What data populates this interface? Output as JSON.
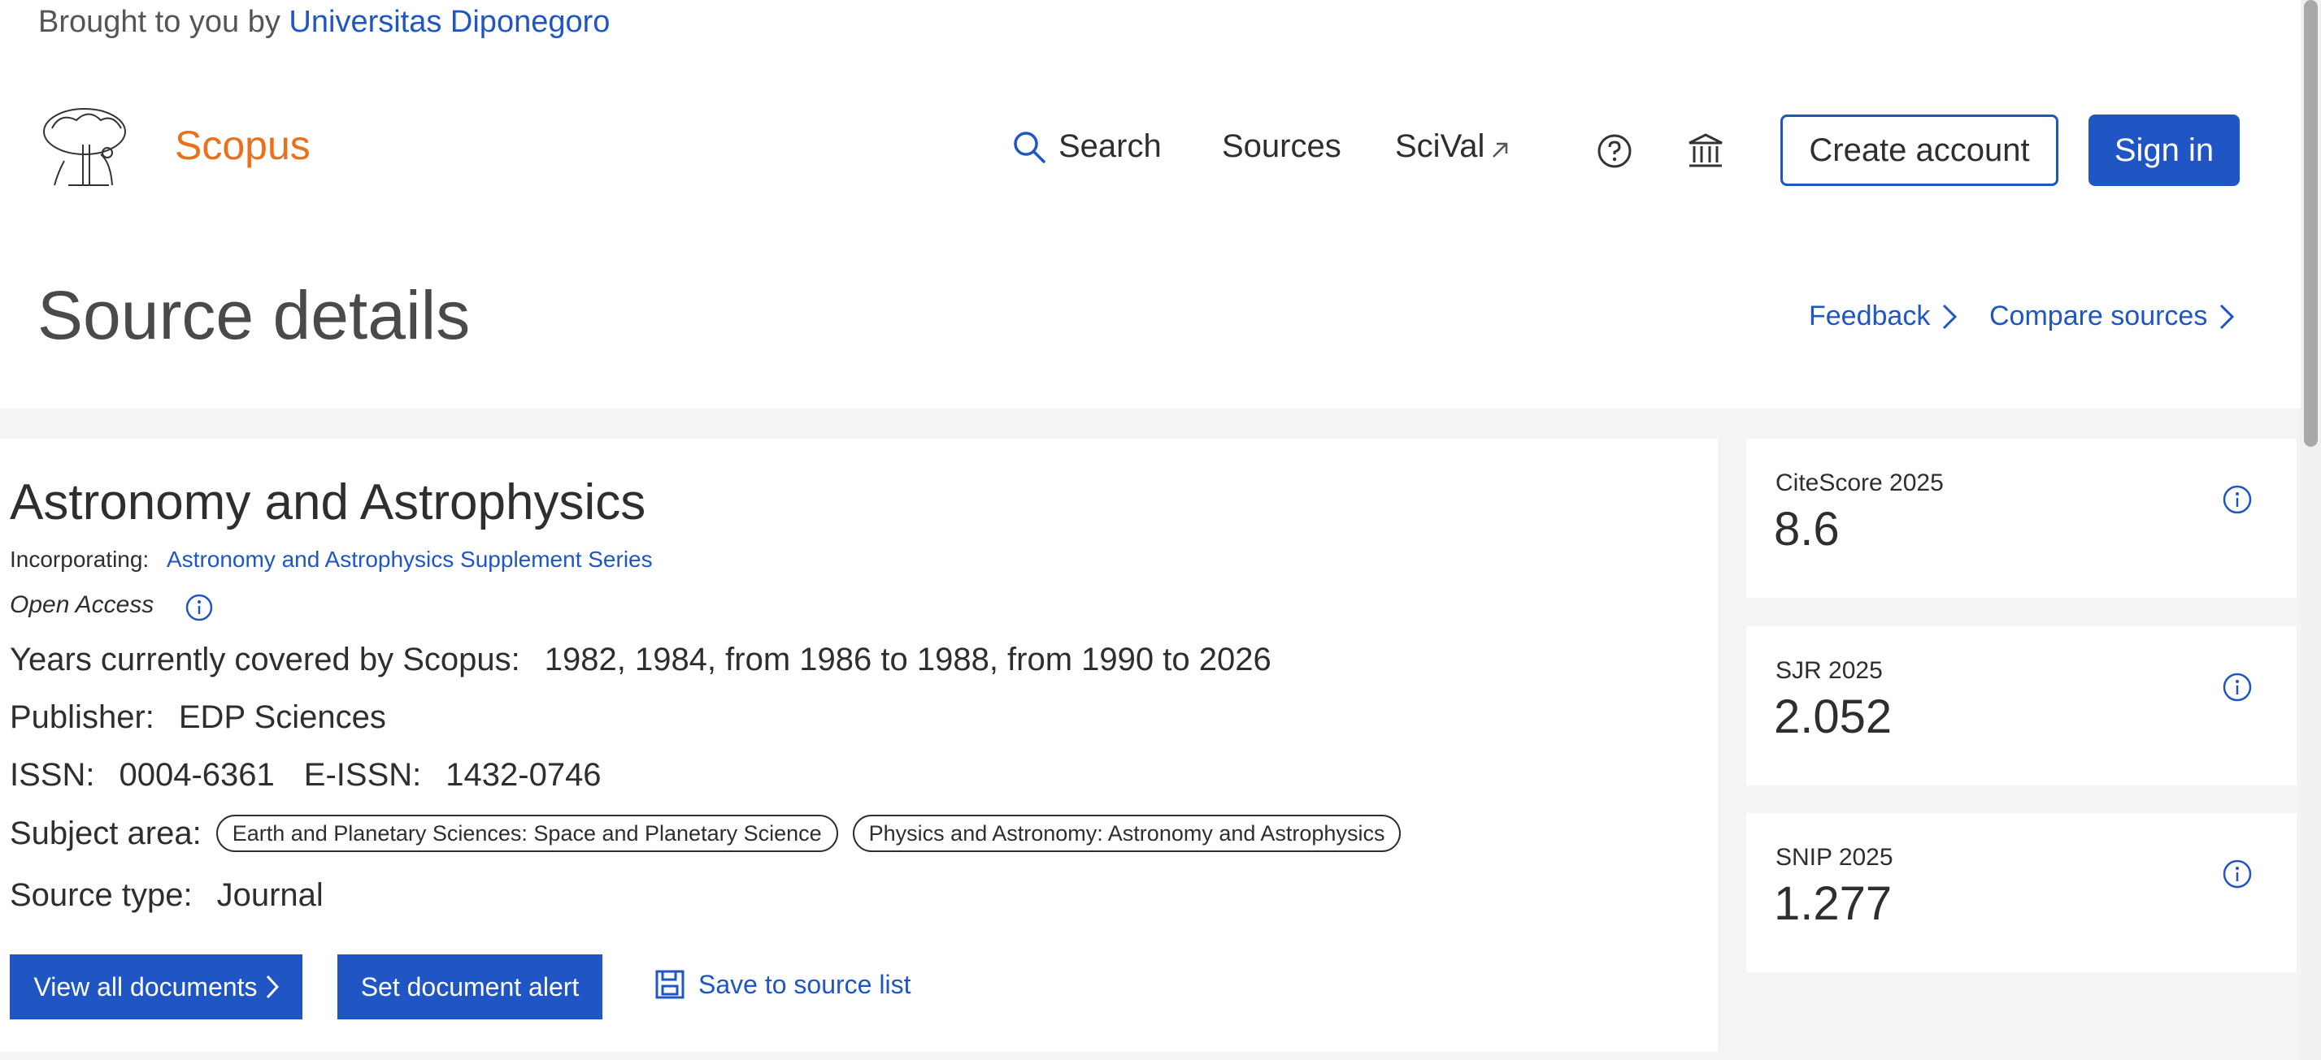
{
  "header": {
    "brought_prefix": "Brought to you by",
    "institution": "Universitas Diponegoro",
    "brand": "Scopus"
  },
  "nav": {
    "search": "Search",
    "sources": "Sources",
    "scival": "SciVal",
    "create_account": "Create account",
    "sign_in": "Sign in"
  },
  "page": {
    "title": "Source details",
    "feedback": "Feedback",
    "compare": "Compare sources"
  },
  "source": {
    "title": "Astronomy and Astrophysics",
    "incorporating_label": "Incorporating:",
    "incorporating_value": "Astronomy and Astrophysics Supplement Series",
    "open_access": "Open Access",
    "years_label": "Years currently covered by Scopus:",
    "years_value": "1982, 1984, from 1986 to 1988, from 1990 to 2026",
    "publisher_label": "Publisher:",
    "publisher_value": "EDP Sciences",
    "issn_label": "ISSN:",
    "issn_value": "0004-6361",
    "eissn_label": "E-ISSN:",
    "eissn_value": "1432-0746",
    "subject_label": "Subject area:",
    "subjects": [
      "Earth and Planetary Sciences: Space and Planetary Science",
      "Physics and Astronomy: Astronomy and Astrophysics"
    ],
    "type_label": "Source type:",
    "type_value": "Journal"
  },
  "actions": {
    "view_all": "View all documents",
    "set_alert": "Set document alert",
    "save_list": "Save to source list"
  },
  "metrics": [
    {
      "label": "CiteScore 2025",
      "value": "8.6"
    },
    {
      "label": "SJR 2025",
      "value": "2.052"
    },
    {
      "label": "SNIP 2025",
      "value": "1.277"
    }
  ],
  "colors": {
    "accent": "#1f56c4",
    "brand": "#e9711c",
    "band": "#f4f4f4"
  }
}
